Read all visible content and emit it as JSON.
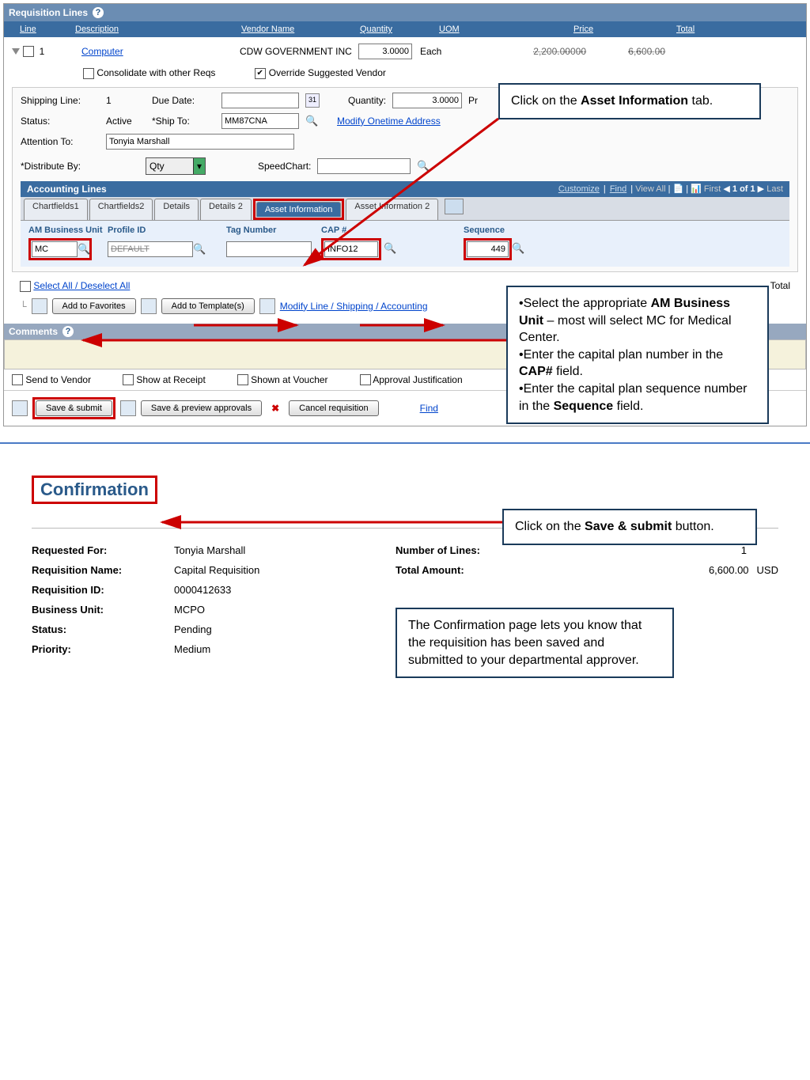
{
  "req_header": {
    "title": "Requisition Lines"
  },
  "columns": {
    "line": "Line",
    "description": "Description",
    "vendor": "Vendor Name",
    "qty": "Quantity",
    "uom": "UOM",
    "price": "Price",
    "total": "Total"
  },
  "line1": {
    "num": "1",
    "desc": "Computer",
    "vendor": "CDW GOVERNMENT INC",
    "qty": "3.0000",
    "uom": "Each",
    "price": "2,200.00000",
    "total": "6,600.00"
  },
  "consolidate_label": "Consolidate with other Reqs",
  "override_label": "Override Suggested Vendor",
  "ship": {
    "shipping_line_label": "Shipping Line:",
    "shipping_line_val": "1",
    "due_date_label": "Due Date:",
    "qty_label": "Quantity:",
    "qty_val": "3.0000",
    "pr": "Pr",
    "status_label": "Status:",
    "status_val": "Active",
    "shipto_label": "*Ship To:",
    "shipto_val": "MM87CNA",
    "modify_link": "Modify Onetime Address",
    "attention_label": "Attention To:",
    "attention_val": "Tonyia Marshall",
    "distribute_label": "*Distribute By:",
    "distribute_val": "Qty",
    "speedchart_label": "SpeedChart:"
  },
  "acct": {
    "title": "Accounting Lines",
    "links": {
      "customize": "Customize",
      "find": "Find",
      "viewall": "View All",
      "first": "First",
      "pager": "1 of 1",
      "last": "Last"
    }
  },
  "tabs": {
    "cf1": "Chartfields1",
    "cf2": "Chartfields2",
    "details": "Details",
    "details2": "Details 2",
    "asset": "Asset Information",
    "asset2": "Asset Information 2"
  },
  "asset_cols": {
    "am": "AM Business Unit",
    "profile": "Profile ID",
    "tag": "Tag Number",
    "cap": "CAP #",
    "seq": "Sequence"
  },
  "asset_vals": {
    "am": "MC",
    "profile": "DEFAULT",
    "cap": "INFO12",
    "seq": "449"
  },
  "select_all": "Select All / Deselect All",
  "total_label": "Total",
  "btns": {
    "fav": "Add to Favorites",
    "template": "Add to Template(s)",
    "modify": "Modify Line / Shipping / Accounting"
  },
  "comments_title": "Comments",
  "checks": {
    "send": "Send to Vendor",
    "show_receipt": "Show at Receipt",
    "show_voucher": "Shown at Voucher",
    "approval": "Approval Justification"
  },
  "action_btns": {
    "save_submit": "Save & submit",
    "save_preview": "Save & preview approvals",
    "cancel": "Cancel requisition",
    "find": "Find"
  },
  "callouts": {
    "c1": "Click on the <b>Asset Information</b> tab.",
    "c2": "•Select the appropriate <b>AM Business Unit</b> – most will select MC for Medical Center.<br>•Enter the capital plan number in the <b>CAP#</b> field.<br>•Enter the capital plan sequence number in the <b>Sequence</b> field.",
    "c3": "Click on the <b>Save & submit</b> button.",
    "c4": "The Confirmation page lets you know that the requisition has been saved and submitted to your departmental approver."
  },
  "confirm": {
    "title": "Confirmation",
    "requested_for_label": "Requested For:",
    "requested_for": "Tonyia Marshall",
    "req_name_label": "Requisition Name:",
    "req_name": "Capital Requisition",
    "req_id_label": "Requisition ID:",
    "req_id": "0000412633",
    "bu_label": "Business Unit:",
    "bu": "MCPO",
    "status_label": "Status:",
    "status": "Pending",
    "priority_label": "Priority:",
    "priority": "Medium",
    "num_lines_label": "Number of Lines:",
    "num_lines": "1",
    "total_label": "Total Amount:",
    "total": "6,600.00",
    "currency": "USD"
  }
}
